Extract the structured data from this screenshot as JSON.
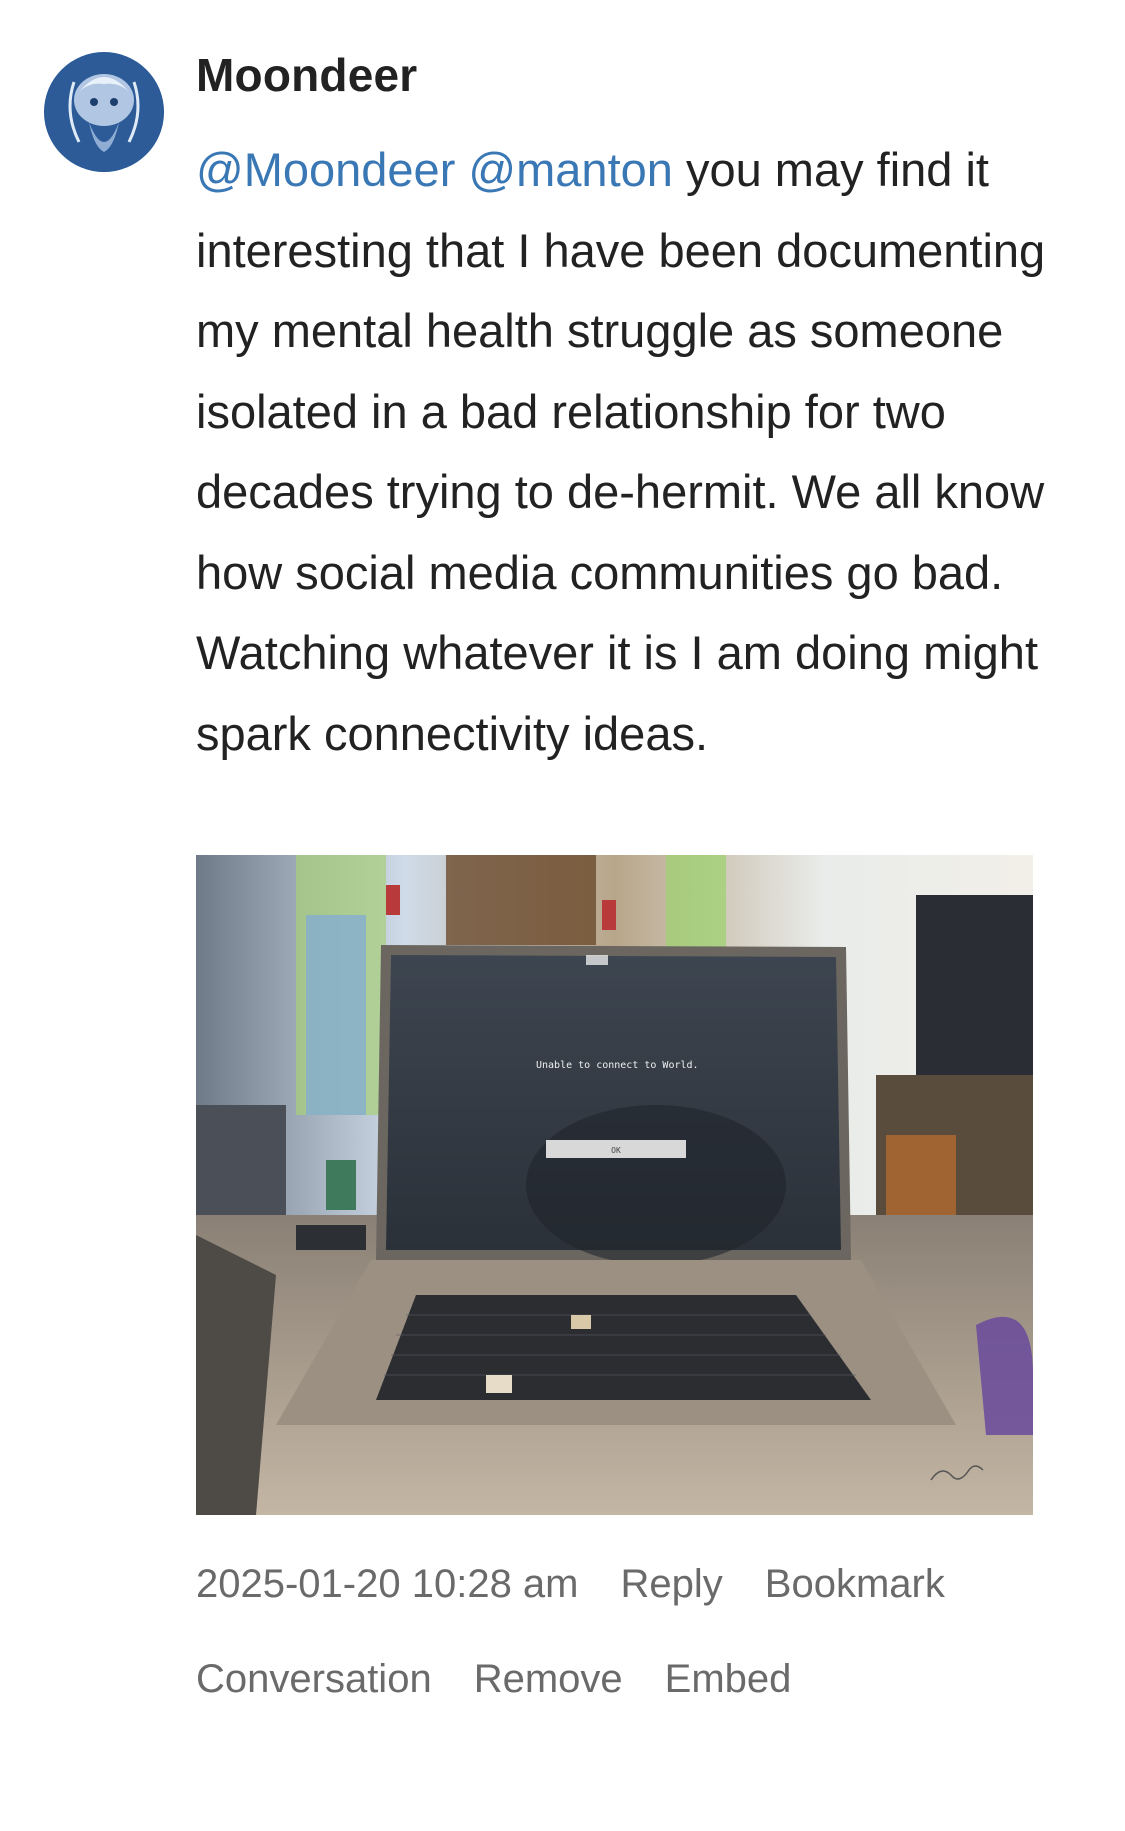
{
  "post": {
    "author": "Moondeer",
    "mentions": [
      "@Moondeer",
      "@manton"
    ],
    "text": "you may find it interesting that I have been documenting my mental health struggle as someone isolated in a bad relationship for two decades trying to de-hermit. We all know how social media communities go bad. Watching whatever it is I am doing might spark connectivity ideas.",
    "image": {
      "screen_message": "Unable to connect to World.",
      "screen_button": "OK"
    },
    "timestamp": "2025-01-20 10:28 am"
  },
  "actions": {
    "reply": "Reply",
    "bookmark": "Bookmark",
    "conversation": "Conversation",
    "remove": "Remove",
    "embed": "Embed"
  },
  "colors": {
    "mention": "#3a78b5",
    "meta": "#6a6a6a",
    "text": "#222222"
  }
}
